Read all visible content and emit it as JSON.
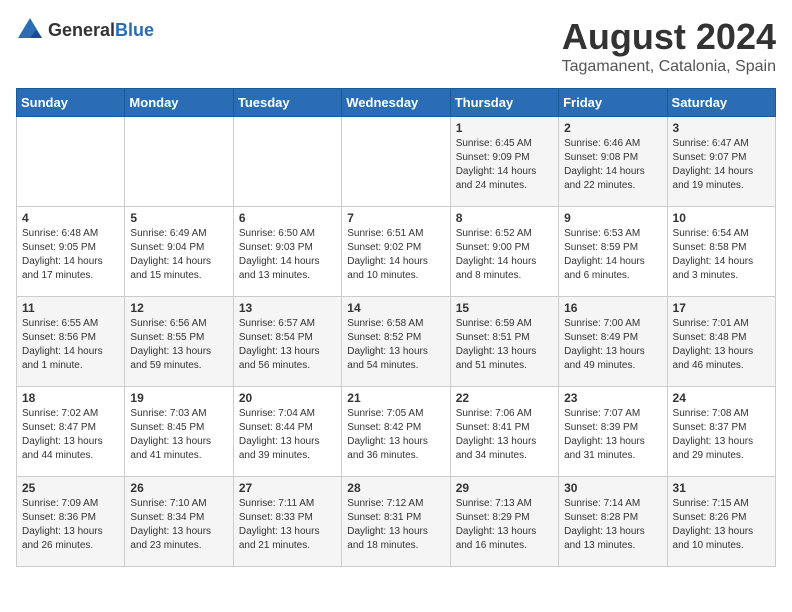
{
  "header": {
    "logo_general": "General",
    "logo_blue": "Blue",
    "month_year": "August 2024",
    "location": "Tagamanent, Catalonia, Spain"
  },
  "days_of_week": [
    "Sunday",
    "Monday",
    "Tuesday",
    "Wednesday",
    "Thursday",
    "Friday",
    "Saturday"
  ],
  "weeks": [
    [
      {
        "day": "",
        "content": ""
      },
      {
        "day": "",
        "content": ""
      },
      {
        "day": "",
        "content": ""
      },
      {
        "day": "",
        "content": ""
      },
      {
        "day": "1",
        "content": "Sunrise: 6:45 AM\nSunset: 9:09 PM\nDaylight: 14 hours and 24 minutes."
      },
      {
        "day": "2",
        "content": "Sunrise: 6:46 AM\nSunset: 9:08 PM\nDaylight: 14 hours and 22 minutes."
      },
      {
        "day": "3",
        "content": "Sunrise: 6:47 AM\nSunset: 9:07 PM\nDaylight: 14 hours and 19 minutes."
      }
    ],
    [
      {
        "day": "4",
        "content": "Sunrise: 6:48 AM\nSunset: 9:05 PM\nDaylight: 14 hours and 17 minutes."
      },
      {
        "day": "5",
        "content": "Sunrise: 6:49 AM\nSunset: 9:04 PM\nDaylight: 14 hours and 15 minutes."
      },
      {
        "day": "6",
        "content": "Sunrise: 6:50 AM\nSunset: 9:03 PM\nDaylight: 14 hours and 13 minutes."
      },
      {
        "day": "7",
        "content": "Sunrise: 6:51 AM\nSunset: 9:02 PM\nDaylight: 14 hours and 10 minutes."
      },
      {
        "day": "8",
        "content": "Sunrise: 6:52 AM\nSunset: 9:00 PM\nDaylight: 14 hours and 8 minutes."
      },
      {
        "day": "9",
        "content": "Sunrise: 6:53 AM\nSunset: 8:59 PM\nDaylight: 14 hours and 6 minutes."
      },
      {
        "day": "10",
        "content": "Sunrise: 6:54 AM\nSunset: 8:58 PM\nDaylight: 14 hours and 3 minutes."
      }
    ],
    [
      {
        "day": "11",
        "content": "Sunrise: 6:55 AM\nSunset: 8:56 PM\nDaylight: 14 hours and 1 minute."
      },
      {
        "day": "12",
        "content": "Sunrise: 6:56 AM\nSunset: 8:55 PM\nDaylight: 13 hours and 59 minutes."
      },
      {
        "day": "13",
        "content": "Sunrise: 6:57 AM\nSunset: 8:54 PM\nDaylight: 13 hours and 56 minutes."
      },
      {
        "day": "14",
        "content": "Sunrise: 6:58 AM\nSunset: 8:52 PM\nDaylight: 13 hours and 54 minutes."
      },
      {
        "day": "15",
        "content": "Sunrise: 6:59 AM\nSunset: 8:51 PM\nDaylight: 13 hours and 51 minutes."
      },
      {
        "day": "16",
        "content": "Sunrise: 7:00 AM\nSunset: 8:49 PM\nDaylight: 13 hours and 49 minutes."
      },
      {
        "day": "17",
        "content": "Sunrise: 7:01 AM\nSunset: 8:48 PM\nDaylight: 13 hours and 46 minutes."
      }
    ],
    [
      {
        "day": "18",
        "content": "Sunrise: 7:02 AM\nSunset: 8:47 PM\nDaylight: 13 hours and 44 minutes."
      },
      {
        "day": "19",
        "content": "Sunrise: 7:03 AM\nSunset: 8:45 PM\nDaylight: 13 hours and 41 minutes."
      },
      {
        "day": "20",
        "content": "Sunrise: 7:04 AM\nSunset: 8:44 PM\nDaylight: 13 hours and 39 minutes."
      },
      {
        "day": "21",
        "content": "Sunrise: 7:05 AM\nSunset: 8:42 PM\nDaylight: 13 hours and 36 minutes."
      },
      {
        "day": "22",
        "content": "Sunrise: 7:06 AM\nSunset: 8:41 PM\nDaylight: 13 hours and 34 minutes."
      },
      {
        "day": "23",
        "content": "Sunrise: 7:07 AM\nSunset: 8:39 PM\nDaylight: 13 hours and 31 minutes."
      },
      {
        "day": "24",
        "content": "Sunrise: 7:08 AM\nSunset: 8:37 PM\nDaylight: 13 hours and 29 minutes."
      }
    ],
    [
      {
        "day": "25",
        "content": "Sunrise: 7:09 AM\nSunset: 8:36 PM\nDaylight: 13 hours and 26 minutes."
      },
      {
        "day": "26",
        "content": "Sunrise: 7:10 AM\nSunset: 8:34 PM\nDaylight: 13 hours and 23 minutes."
      },
      {
        "day": "27",
        "content": "Sunrise: 7:11 AM\nSunset: 8:33 PM\nDaylight: 13 hours and 21 minutes."
      },
      {
        "day": "28",
        "content": "Sunrise: 7:12 AM\nSunset: 8:31 PM\nDaylight: 13 hours and 18 minutes."
      },
      {
        "day": "29",
        "content": "Sunrise: 7:13 AM\nSunset: 8:29 PM\nDaylight: 13 hours and 16 minutes."
      },
      {
        "day": "30",
        "content": "Sunrise: 7:14 AM\nSunset: 8:28 PM\nDaylight: 13 hours and 13 minutes."
      },
      {
        "day": "31",
        "content": "Sunrise: 7:15 AM\nSunset: 8:26 PM\nDaylight: 13 hours and 10 minutes."
      }
    ]
  ]
}
